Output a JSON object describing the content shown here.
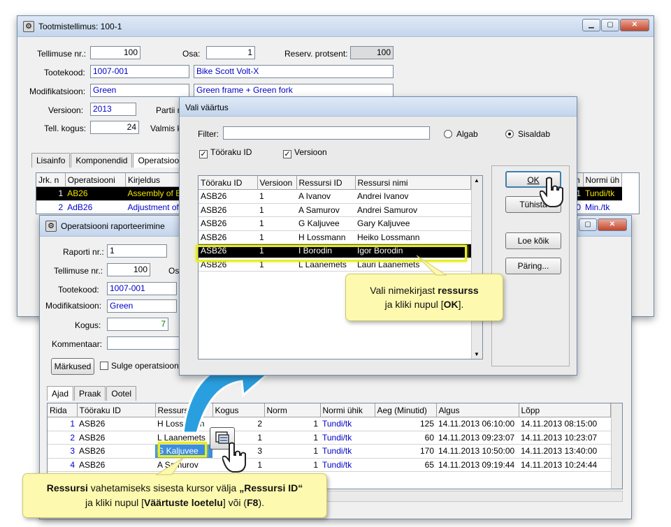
{
  "main_window": {
    "title": "Tootmistellimus: 100-1",
    "labels": {
      "order_nr": "Tellimuse nr.:",
      "part": "Osa:",
      "reserve_percent": "Reserv. protsent:",
      "product_code": "Tootekood:",
      "modification": "Modifikatsioon:",
      "version": "Versioon:",
      "batch": "Partii n",
      "quantity": "Tell. kogus:",
      "finished": "Valmis k"
    },
    "values": {
      "order_nr": "100",
      "part": "1",
      "reserve_percent": "100",
      "product_code": "1007-001",
      "product_name": "Bike Scott Volt-X",
      "modification": "Green",
      "modification_desc": "Green frame + Green fork",
      "version": "2013",
      "quantity": "24"
    },
    "tabs": [
      "Lisainfo",
      "Komponendid",
      "Operatsioonid"
    ],
    "op_grid": {
      "headers": [
        "Jrk. n",
        "Operatsiooni",
        "Kirjeldus"
      ],
      "rows": [
        [
          "1",
          "AB26",
          "Assembly of Bikes"
        ],
        [
          "2",
          "AdB26",
          "Adjustment of Bike"
        ]
      ],
      "right_headers": [
        "n",
        "Normi üh"
      ],
      "right_rows": [
        [
          "1",
          "Tundi/tk"
        ],
        [
          "0",
          "Min./tk"
        ]
      ]
    }
  },
  "report_window": {
    "title": "Operatsiooni raporteerimine",
    "labels": {
      "report_nr": "Raporti nr.:",
      "order_nr": "Tellimuse nr.:",
      "part": "Os",
      "product_code": "Tootekood:",
      "modification": "Modifikatsioon:",
      "quantity": "Kogus:",
      "comment": "Kommentaar:"
    },
    "values": {
      "report_nr": "1",
      "order_nr": "100",
      "product_code": "1007-001",
      "modification": "Green",
      "quantity": "7"
    },
    "notes_button": "Märkused",
    "close_op_label": "Sulge operatsioon",
    "tabs": [
      "Ajad",
      "Praak",
      "Ootel"
    ],
    "grid": {
      "headers": [
        "Rida",
        "Tööraku ID",
        "Ressursi ID",
        "Kogus",
        "Norm",
        "Normi ühik",
        "Aeg (Minutid)",
        "Algus",
        "Lõpp"
      ],
      "rows": [
        [
          "1",
          "ASB26",
          "H Lossmann",
          "2",
          "1",
          "Tundi/tk",
          "125",
          "14.11.2013 06:10:00",
          "14.11.2013 08:15:00"
        ],
        [
          "2",
          "ASB26",
          "L Laanemets",
          "1",
          "1",
          "Tundi/tk",
          "60",
          "14.11.2013 09:23:07",
          "14.11.2013 10:23:07"
        ],
        [
          "3",
          "ASB26",
          "G Kaljuvee",
          "3",
          "1",
          "Tundi/tk",
          "170",
          "14.11.2013 10:50:00",
          "14.11.2013 13:40:00"
        ],
        [
          "4",
          "ASB26",
          "A Samurov",
          "1",
          "1",
          "Tundi/tk",
          "65",
          "14.11.2013 09:19:44",
          "14.11.2013 10:24:44"
        ]
      ]
    }
  },
  "value_dialog": {
    "title": "Vali väärtus",
    "filter_label": "Filter:",
    "filter_value": "",
    "radio_starts": "Algab",
    "radio_contains": "Sisaldab",
    "check_workcell": "Tööraku ID",
    "check_version": "Versioon",
    "headers": [
      "Tööraku ID",
      "Versioon",
      "Ressursi ID",
      "Ressursi nimi"
    ],
    "rows": [
      [
        "ASB26",
        "1",
        "A Ivanov",
        "Andrei Ivanov"
      ],
      [
        "ASB26",
        "1",
        "A Samurov",
        "Andrei Samurov"
      ],
      [
        "ASB26",
        "1",
        "G Kaljuvee",
        "Gary Kaljuvee"
      ],
      [
        "ASB26",
        "1",
        "H Lossmann",
        "Heiko Lossmann"
      ],
      [
        "ASB26",
        "1",
        "I Borodin",
        "Igor Borodin"
      ],
      [
        "ASB26",
        "1",
        "L Laanemets",
        "Lauri Laanemets"
      ]
    ],
    "selected_row": 4,
    "buttons": {
      "ok": "OK",
      "cancel": "Tühista",
      "load_all": "Loe kõik",
      "query": "Päring..."
    }
  },
  "callout_top": {
    "line1_prefix": "Vali nimekirjast ",
    "line1_bold": "ressurss",
    "line2_prefix": "ja kliki nupul [",
    "line2_bold": "OK",
    "line2_suffix": "]."
  },
  "callout_bottom": {
    "line1_bold1": "Ressursi",
    "line1_mid": " vahetamiseks sisesta kursor välja ",
    "line1_bold2": "„Ressursi ID“",
    "line2_prefix": "ja kliki nupul [",
    "line2_bold": "Väärtuste loetelu",
    "line2_mid": "] või (",
    "line2_bold2": "F8",
    "line2_suffix": ")."
  },
  "colors": {
    "highlight": "#e8ec2a",
    "arrow": "#2a9fe0",
    "callout": "#fdf9ae",
    "link_blue": "#0000c8"
  }
}
